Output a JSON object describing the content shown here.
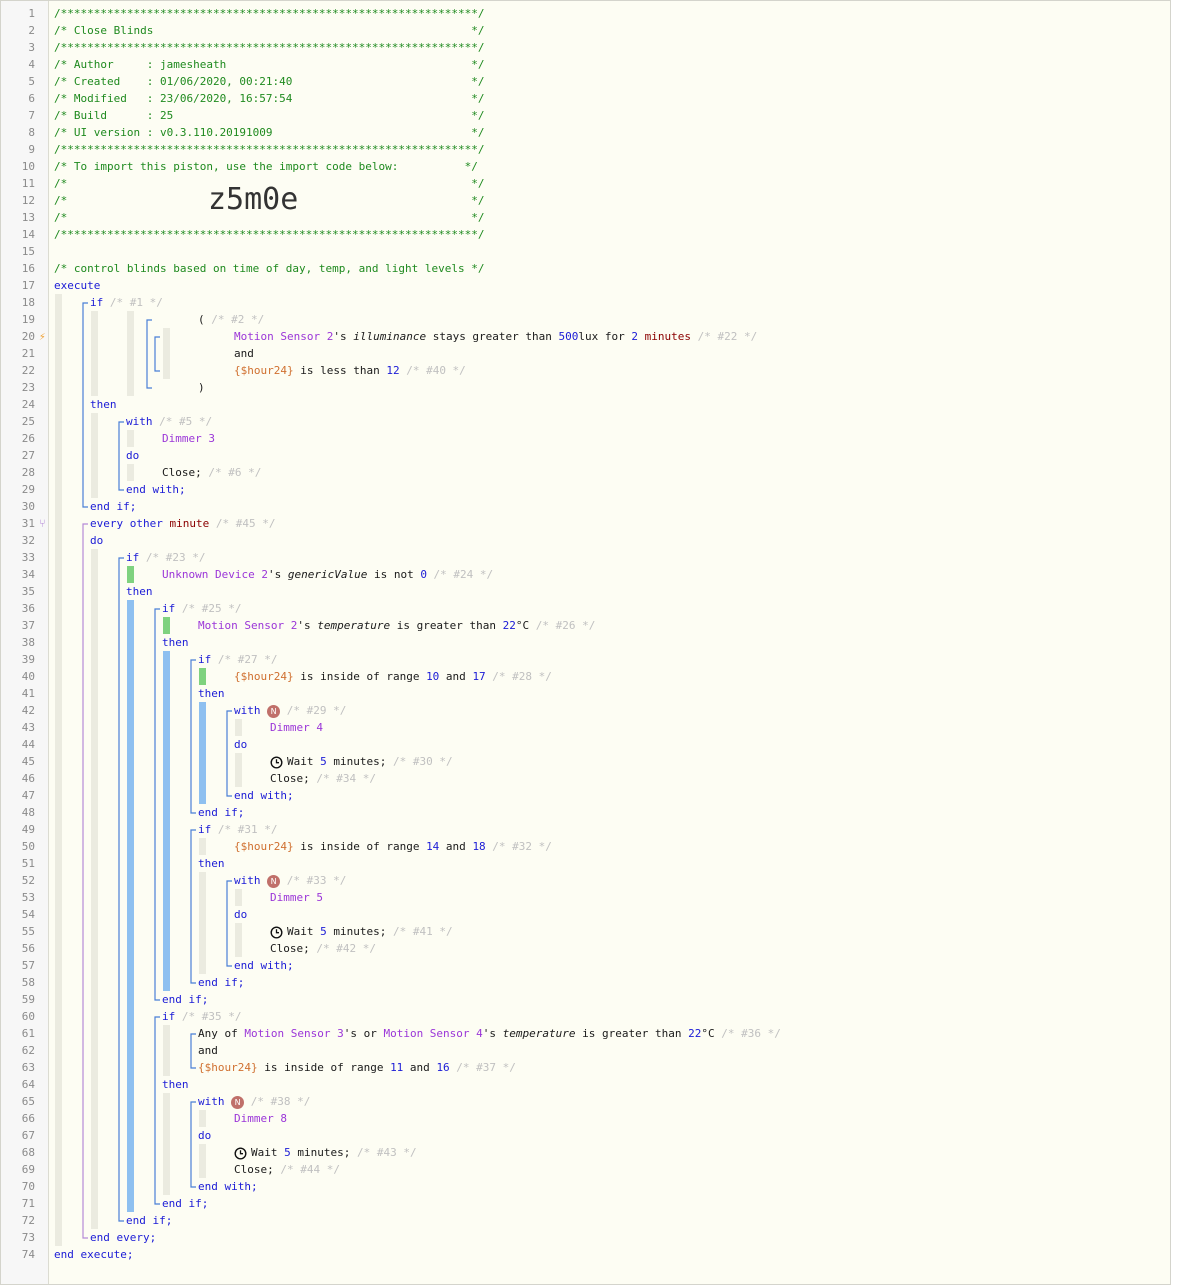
{
  "import_code": "z5m0e",
  "lines": [
    {
      "num": "1",
      "indent": 0,
      "segments": [
        {
          "c": "c",
          "t": "/***************************************************************/"
        }
      ]
    },
    {
      "num": "2",
      "indent": 0,
      "segments": [
        {
          "c": "c",
          "t": "/* Close Blinds                                                */"
        }
      ]
    },
    {
      "num": "3",
      "indent": 0,
      "segments": [
        {
          "c": "c",
          "t": "/***************************************************************/"
        }
      ]
    },
    {
      "num": "4",
      "indent": 0,
      "segments": [
        {
          "c": "c",
          "t": "/* Author     : jamesheath                                     */"
        }
      ]
    },
    {
      "num": "5",
      "indent": 0,
      "segments": [
        {
          "c": "c",
          "t": "/* Created    : 01/06/2020, 00:21:40                           */"
        }
      ]
    },
    {
      "num": "6",
      "indent": 0,
      "segments": [
        {
          "c": "c",
          "t": "/* Modified   : 23/06/2020, 16:57:54                           */"
        }
      ]
    },
    {
      "num": "7",
      "indent": 0,
      "segments": [
        {
          "c": "c",
          "t": "/* Build      : 25                                             */"
        }
      ]
    },
    {
      "num": "8",
      "indent": 0,
      "segments": [
        {
          "c": "c",
          "t": "/* UI version : v0.3.110.20191009                              */"
        }
      ]
    },
    {
      "num": "9",
      "indent": 0,
      "segments": [
        {
          "c": "c",
          "t": "/***************************************************************/"
        }
      ]
    },
    {
      "num": "10",
      "indent": 0,
      "segments": [
        {
          "c": "c",
          "t": "/* To import this piston, use the import code below:          */"
        }
      ]
    },
    {
      "num": "11",
      "indent": 0,
      "segments": [
        {
          "c": "c",
          "t": "/*                                                             */"
        }
      ]
    },
    {
      "num": "12",
      "indent": 0,
      "segments": [
        {
          "c": "c",
          "t": "/*                                                             */"
        }
      ]
    },
    {
      "num": "13",
      "indent": 0,
      "segments": [
        {
          "c": "c",
          "t": "/*                                                             */"
        }
      ]
    },
    {
      "num": "14",
      "indent": 0,
      "segments": [
        {
          "c": "c",
          "t": "/***************************************************************/"
        }
      ]
    },
    {
      "num": "15",
      "indent": 0,
      "segments": []
    },
    {
      "num": "16",
      "indent": 0,
      "segments": [
        {
          "c": "c",
          "t": "/* control blinds based on time of day, temp, and light levels */"
        }
      ]
    },
    {
      "num": "17",
      "indent": 0,
      "segments": [
        {
          "c": "k",
          "t": "execute"
        }
      ]
    },
    {
      "num": "18",
      "indent": 1,
      "segments": [
        {
          "c": "k",
          "t": "if"
        },
        {
          "c": "x",
          "t": " /* #1 */"
        }
      ]
    },
    {
      "num": "19",
      "indent": 4,
      "segments": [
        {
          "c": "p",
          "t": "( "
        },
        {
          "c": "x",
          "t": "/* #2 */"
        }
      ]
    },
    {
      "num": "20",
      "indent": 5,
      "marker": "bolt",
      "segments": [
        {
          "c": "d",
          "t": "Motion Sensor 2"
        },
        {
          "c": "p",
          "t": "'s "
        },
        {
          "c": "i",
          "t": "illuminance"
        },
        {
          "c": "p",
          "t": " stays greater than "
        },
        {
          "c": "n",
          "t": "500"
        },
        {
          "c": "p",
          "t": "lux for "
        },
        {
          "c": "n",
          "t": "2"
        },
        {
          "c": "p",
          "t": " "
        },
        {
          "c": "t",
          "t": "minutes"
        },
        {
          "c": "x",
          "t": " /* #22 */"
        }
      ]
    },
    {
      "num": "21",
      "indent": 5,
      "segments": [
        {
          "c": "p",
          "t": "and"
        }
      ]
    },
    {
      "num": "22",
      "indent": 5,
      "segments": [
        {
          "c": "v",
          "t": "{$hour24}"
        },
        {
          "c": "p",
          "t": " is less than "
        },
        {
          "c": "n",
          "t": "12"
        },
        {
          "c": "x",
          "t": " /* #40 */"
        }
      ]
    },
    {
      "num": "23",
      "indent": 4,
      "segments": [
        {
          "c": "p",
          "t": ")"
        }
      ]
    },
    {
      "num": "24",
      "indent": 1,
      "segments": [
        {
          "c": "k",
          "t": "then"
        }
      ]
    },
    {
      "num": "25",
      "indent": 2,
      "segments": [
        {
          "c": "k",
          "t": "with"
        },
        {
          "c": "x",
          "t": " /* #5 */"
        }
      ]
    },
    {
      "num": "26",
      "indent": 3,
      "segments": [
        {
          "c": "d",
          "t": "Dimmer 3"
        }
      ]
    },
    {
      "num": "27",
      "indent": 2,
      "segments": [
        {
          "c": "k",
          "t": "do"
        }
      ]
    },
    {
      "num": "28",
      "indent": 3,
      "segments": [
        {
          "c": "p",
          "t": "Close;"
        },
        {
          "c": "x",
          "t": " /* #6 */"
        }
      ]
    },
    {
      "num": "29",
      "indent": 2,
      "segments": [
        {
          "c": "k",
          "t": "end with;"
        }
      ]
    },
    {
      "num": "30",
      "indent": 1,
      "segments": [
        {
          "c": "k",
          "t": "end if;"
        }
      ]
    },
    {
      "num": "31",
      "indent": 1,
      "marker": "branch",
      "segments": [
        {
          "c": "k",
          "t": "every other "
        },
        {
          "c": "t",
          "t": "minute"
        },
        {
          "c": "x",
          "t": " /* #45 */"
        }
      ]
    },
    {
      "num": "32",
      "indent": 1,
      "segments": [
        {
          "c": "k",
          "t": "do"
        }
      ]
    },
    {
      "num": "33",
      "indent": 2,
      "segments": [
        {
          "c": "k",
          "t": "if"
        },
        {
          "c": "x",
          "t": " /* #23 */"
        }
      ]
    },
    {
      "num": "34",
      "indent": 3,
      "segments": [
        {
          "c": "d",
          "t": "Unknown Device 2"
        },
        {
          "c": "p",
          "t": "'s "
        },
        {
          "c": "i",
          "t": "genericValue"
        },
        {
          "c": "p",
          "t": " is not "
        },
        {
          "c": "n",
          "t": "0"
        },
        {
          "c": "x",
          "t": " /* #24 */"
        }
      ]
    },
    {
      "num": "35",
      "indent": 2,
      "segments": [
        {
          "c": "k",
          "t": "then"
        }
      ]
    },
    {
      "num": "36",
      "indent": 3,
      "segments": [
        {
          "c": "k",
          "t": "if"
        },
        {
          "c": "x",
          "t": " /* #25 */"
        }
      ]
    },
    {
      "num": "37",
      "indent": 4,
      "segments": [
        {
          "c": "d",
          "t": "Motion Sensor 2"
        },
        {
          "c": "p",
          "t": "'s "
        },
        {
          "c": "i",
          "t": "temperature"
        },
        {
          "c": "p",
          "t": " is greater than "
        },
        {
          "c": "n",
          "t": "22"
        },
        {
          "c": "p",
          "t": "°C"
        },
        {
          "c": "x",
          "t": " /* #26 */"
        }
      ]
    },
    {
      "num": "38",
      "indent": 3,
      "segments": [
        {
          "c": "k",
          "t": "then"
        }
      ]
    },
    {
      "num": "39",
      "indent": 4,
      "segments": [
        {
          "c": "k",
          "t": "if"
        },
        {
          "c": "x",
          "t": " /* #27 */"
        }
      ]
    },
    {
      "num": "40",
      "indent": 5,
      "segments": [
        {
          "c": "v",
          "t": "{$hour24}"
        },
        {
          "c": "p",
          "t": " is inside of range "
        },
        {
          "c": "n",
          "t": "10"
        },
        {
          "c": "p",
          "t": " and "
        },
        {
          "c": "n",
          "t": "17"
        },
        {
          "c": "x",
          "t": " /* #28 */"
        }
      ]
    },
    {
      "num": "41",
      "indent": 4,
      "segments": [
        {
          "c": "k",
          "t": "then"
        }
      ]
    },
    {
      "num": "42",
      "indent": 5,
      "segments": [
        {
          "c": "k",
          "t": "with "
        },
        {
          "c": "badge",
          "t": "N"
        },
        {
          "c": "x",
          "t": " /* #29 */"
        }
      ]
    },
    {
      "num": "43",
      "indent": 6,
      "segments": [
        {
          "c": "d",
          "t": "Dimmer 4"
        }
      ]
    },
    {
      "num": "44",
      "indent": 5,
      "segments": [
        {
          "c": "k",
          "t": "do"
        }
      ]
    },
    {
      "num": "45",
      "indent": 6,
      "segments": [
        {
          "c": "clock",
          "t": ""
        },
        {
          "c": "p",
          "t": "Wait "
        },
        {
          "c": "n",
          "t": "5"
        },
        {
          "c": "p",
          "t": " minutes;"
        },
        {
          "c": "x",
          "t": " /* #30 */"
        }
      ]
    },
    {
      "num": "46",
      "indent": 6,
      "segments": [
        {
          "c": "p",
          "t": "Close;"
        },
        {
          "c": "x",
          "t": " /* #34 */"
        }
      ]
    },
    {
      "num": "47",
      "indent": 5,
      "segments": [
        {
          "c": "k",
          "t": "end with;"
        }
      ]
    },
    {
      "num": "48",
      "indent": 4,
      "segments": [
        {
          "c": "k",
          "t": "end if;"
        }
      ]
    },
    {
      "num": "49",
      "indent": 4,
      "segments": [
        {
          "c": "k",
          "t": "if"
        },
        {
          "c": "x",
          "t": " /* #31 */"
        }
      ]
    },
    {
      "num": "50",
      "indent": 5,
      "segments": [
        {
          "c": "v",
          "t": "{$hour24}"
        },
        {
          "c": "p",
          "t": " is inside of range "
        },
        {
          "c": "n",
          "t": "14"
        },
        {
          "c": "p",
          "t": " and "
        },
        {
          "c": "n",
          "t": "18"
        },
        {
          "c": "x",
          "t": " /* #32 */"
        }
      ]
    },
    {
      "num": "51",
      "indent": 4,
      "segments": [
        {
          "c": "k",
          "t": "then"
        }
      ]
    },
    {
      "num": "52",
      "indent": 5,
      "segments": [
        {
          "c": "k",
          "t": "with "
        },
        {
          "c": "badge",
          "t": "N"
        },
        {
          "c": "x",
          "t": " /* #33 */"
        }
      ]
    },
    {
      "num": "53",
      "indent": 6,
      "segments": [
        {
          "c": "d",
          "t": "Dimmer 5"
        }
      ]
    },
    {
      "num": "54",
      "indent": 5,
      "segments": [
        {
          "c": "k",
          "t": "do"
        }
      ]
    },
    {
      "num": "55",
      "indent": 6,
      "segments": [
        {
          "c": "clock",
          "t": ""
        },
        {
          "c": "p",
          "t": "Wait "
        },
        {
          "c": "n",
          "t": "5"
        },
        {
          "c": "p",
          "t": " minutes;"
        },
        {
          "c": "x",
          "t": " /* #41 */"
        }
      ]
    },
    {
      "num": "56",
      "indent": 6,
      "segments": [
        {
          "c": "p",
          "t": "Close;"
        },
        {
          "c": "x",
          "t": " /* #42 */"
        }
      ]
    },
    {
      "num": "57",
      "indent": 5,
      "segments": [
        {
          "c": "k",
          "t": "end with;"
        }
      ]
    },
    {
      "num": "58",
      "indent": 4,
      "segments": [
        {
          "c": "k",
          "t": "end if;"
        }
      ]
    },
    {
      "num": "59",
      "indent": 3,
      "segments": [
        {
          "c": "k",
          "t": "end if;"
        }
      ]
    },
    {
      "num": "60",
      "indent": 3,
      "segments": [
        {
          "c": "k",
          "t": "if"
        },
        {
          "c": "x",
          "t": " /* #35 */"
        }
      ]
    },
    {
      "num": "61",
      "indent": 4,
      "segments": [
        {
          "c": "p",
          "t": "Any of "
        },
        {
          "c": "d",
          "t": "Motion Sensor 3"
        },
        {
          "c": "p",
          "t": "'s or "
        },
        {
          "c": "d",
          "t": "Motion Sensor 4"
        },
        {
          "c": "p",
          "t": "'s "
        },
        {
          "c": "i",
          "t": "temperature"
        },
        {
          "c": "p",
          "t": " is greater than "
        },
        {
          "c": "n",
          "t": "22"
        },
        {
          "c": "p",
          "t": "°C"
        },
        {
          "c": "x",
          "t": " /* #36 */"
        }
      ]
    },
    {
      "num": "62",
      "indent": 4,
      "segments": [
        {
          "c": "p",
          "t": "and"
        }
      ]
    },
    {
      "num": "63",
      "indent": 4,
      "segments": [
        {
          "c": "v",
          "t": "{$hour24}"
        },
        {
          "c": "p",
          "t": " is inside of range "
        },
        {
          "c": "n",
          "t": "11"
        },
        {
          "c": "p",
          "t": " and "
        },
        {
          "c": "n",
          "t": "16"
        },
        {
          "c": "x",
          "t": " /* #37 */"
        }
      ]
    },
    {
      "num": "64",
      "indent": 3,
      "segments": [
        {
          "c": "k",
          "t": "then"
        }
      ]
    },
    {
      "num": "65",
      "indent": 4,
      "segments": [
        {
          "c": "k",
          "t": "with "
        },
        {
          "c": "badge",
          "t": "N"
        },
        {
          "c": "x",
          "t": " /* #38 */"
        }
      ]
    },
    {
      "num": "66",
      "indent": 5,
      "segments": [
        {
          "c": "d",
          "t": "Dimmer 8"
        }
      ]
    },
    {
      "num": "67",
      "indent": 4,
      "segments": [
        {
          "c": "k",
          "t": "do"
        }
      ]
    },
    {
      "num": "68",
      "indent": 5,
      "segments": [
        {
          "c": "clock",
          "t": ""
        },
        {
          "c": "p",
          "t": "Wait "
        },
        {
          "c": "n",
          "t": "5"
        },
        {
          "c": "p",
          "t": " minutes;"
        },
        {
          "c": "x",
          "t": " /* #43 */"
        }
      ]
    },
    {
      "num": "69",
      "indent": 5,
      "segments": [
        {
          "c": "p",
          "t": "Close;"
        },
        {
          "c": "x",
          "t": " /* #44 */"
        }
      ]
    },
    {
      "num": "70",
      "indent": 4,
      "segments": [
        {
          "c": "k",
          "t": "end with;"
        }
      ]
    },
    {
      "num": "71",
      "indent": 3,
      "segments": [
        {
          "c": "k",
          "t": "end if;"
        }
      ]
    },
    {
      "num": "72",
      "indent": 2,
      "segments": [
        {
          "c": "k",
          "t": "end if;"
        }
      ]
    },
    {
      "num": "73",
      "indent": 1,
      "segments": [
        {
          "c": "k",
          "t": "end every;"
        }
      ]
    },
    {
      "num": "74",
      "indent": 0,
      "segments": [
        {
          "c": "k",
          "t": "end execute;"
        }
      ]
    }
  ]
}
